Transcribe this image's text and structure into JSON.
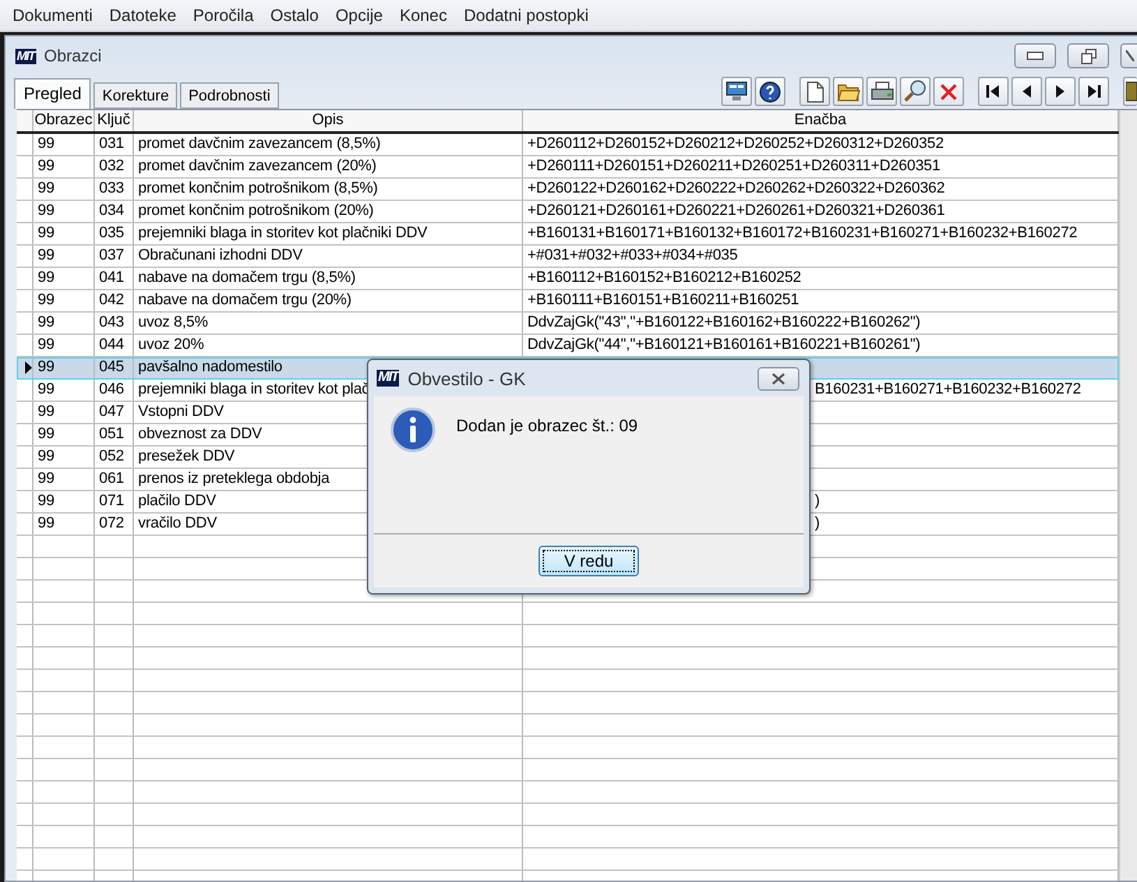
{
  "menu": [
    "Dokumenti",
    "Datoteke",
    "Poročila",
    "Ostalo",
    "Opcije",
    "Konec",
    "Dodatni postopki"
  ],
  "window": {
    "logo": "MIT",
    "title": "Obrazci"
  },
  "tabs": [
    {
      "label": "Pregled",
      "selected": true
    },
    {
      "label": "Korekture",
      "selected": false
    },
    {
      "label": "Podrobnosti",
      "selected": false
    }
  ],
  "toolbar": [
    {
      "kind": "screen"
    },
    {
      "kind": "help"
    },
    {
      "kind": "gap"
    },
    {
      "kind": "new"
    },
    {
      "kind": "open"
    },
    {
      "kind": "print"
    },
    {
      "kind": "search"
    },
    {
      "kind": "delete"
    },
    {
      "kind": "gap"
    },
    {
      "kind": "first"
    },
    {
      "kind": "prev"
    },
    {
      "kind": "next"
    },
    {
      "kind": "last"
    },
    {
      "kind": "gap"
    },
    {
      "kind": "exit"
    }
  ],
  "table": {
    "columns": [
      "Obrazec",
      "Ključ",
      "Opis",
      "Enačba"
    ],
    "rows": [
      {
        "obrazec": "99",
        "kljuc": "031",
        "opis": "promet davčnim zavezancem (8,5%)",
        "enacba": "+D260112+D260152+D260212+D260252+D260312+D260352",
        "selected": false
      },
      {
        "obrazec": "99",
        "kljuc": "032",
        "opis": "promet davčnim zavezancem (20%)",
        "enacba": "+D260111+D260151+D260211+D260251+D260311+D260351",
        "selected": false
      },
      {
        "obrazec": "99",
        "kljuc": "033",
        "opis": "promet končnim potrošnikom (8,5%)",
        "enacba": "+D260122+D260162+D260222+D260262+D260322+D260362",
        "selected": false
      },
      {
        "obrazec": "99",
        "kljuc": "034",
        "opis": "promet končnim potrošnikom (20%)",
        "enacba": "+D260121+D260161+D260221+D260261+D260321+D260361",
        "selected": false
      },
      {
        "obrazec": "99",
        "kljuc": "035",
        "opis": "prejemniki blaga in storitev kot plačniki DDV",
        "enacba": "+B160131+B160171+B160132+B160172+B160231+B160271+B160232+B160272",
        "selected": false
      },
      {
        "obrazec": "99",
        "kljuc": "037",
        "opis": "Obračunani izhodni DDV",
        "enacba": "+#031+#032+#033+#034+#035",
        "selected": false
      },
      {
        "obrazec": "99",
        "kljuc": "041",
        "opis": "nabave na domačem trgu (8,5%)",
        "enacba": "+B160112+B160152+B160212+B160252",
        "selected": false
      },
      {
        "obrazec": "99",
        "kljuc": "042",
        "opis": "nabave na domačem trgu (20%)",
        "enacba": "+B160111+B160151+B160211+B160251",
        "selected": false
      },
      {
        "obrazec": "99",
        "kljuc": "043",
        "opis": "uvoz 8,5%",
        "enacba": "DdvZajGk(\"43\",\"+B160122+B160162+B160222+B160262\")",
        "selected": false
      },
      {
        "obrazec": "99",
        "kljuc": "044",
        "opis": "uvoz 20%",
        "enacba": "DdvZajGk(\"44\",\"+B160121+B160161+B160221+B160261\")",
        "selected": false
      },
      {
        "obrazec": "99",
        "kljuc": "045",
        "opis": "pavšalno nadomestilo",
        "selected": true
      },
      {
        "obrazec": "99",
        "kljuc": "046",
        "opis": "prejemniki blaga in storitev kot plač",
        "enacba": "B160231+B160271+B160232+B160272",
        "enacba_cut": true,
        "selected": false
      },
      {
        "obrazec": "99",
        "kljuc": "047",
        "opis": "Vstopni DDV",
        "selected": false
      },
      {
        "obrazec": "99",
        "kljuc": "051",
        "opis": "obveznost za DDV",
        "selected": false
      },
      {
        "obrazec": "99",
        "kljuc": "052",
        "opis": "presežek DDV",
        "selected": false
      },
      {
        "obrazec": "99",
        "kljuc": "061",
        "opis": "prenos iz preteklega obdobja",
        "selected": false
      },
      {
        "obrazec": "99",
        "kljuc": "071",
        "opis": "plačilo DDV",
        "enacba": ")",
        "enacba_cut": true,
        "selected": false
      },
      {
        "obrazec": "99",
        "kljuc": "072",
        "opis": "vračilo DDV",
        "enacba": ")",
        "enacba_cut": true,
        "selected": false
      }
    ]
  },
  "dialog": {
    "logo": "MIT",
    "title": "Obvestilo - GK",
    "message": "Dodan je obrazec št.: 09",
    "button": "V redu"
  }
}
